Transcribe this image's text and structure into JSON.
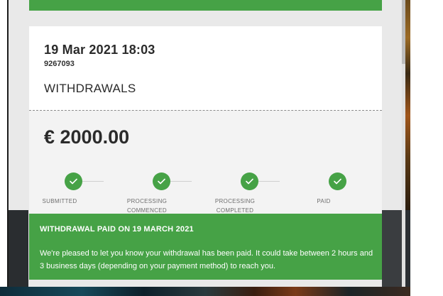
{
  "transaction": {
    "date": "19 Mar 2021 18:03",
    "reference": "9267093",
    "type": "WITHDRAWALS",
    "amount": "€ 2000.00"
  },
  "progress": {
    "steps": [
      {
        "label": "SUBMITTED",
        "completed": true
      },
      {
        "label": "PROCESSING COMMENCED",
        "completed": true
      },
      {
        "label": "PROCESSING COMPLETED",
        "completed": true
      },
      {
        "label": "PAID",
        "completed": true
      }
    ],
    "icon": "checkmark-icon"
  },
  "notice": {
    "title": "WITHDRAWAL PAID ON 19 MARCH 2021",
    "message": "We're pleased to let you know your withdrawal has been paid. It could take between 2 hours and 3 business days (depending on your payment method) to reach you."
  },
  "colors": {
    "accent_green": "#46a246",
    "panel_bg": "#e9e9e9",
    "card_body_bg": "#f3f3f3",
    "text_dark": "#2b2b2b",
    "label_grey": "#6e6e6e"
  }
}
